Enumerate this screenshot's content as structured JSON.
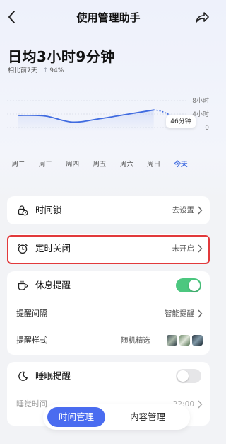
{
  "header": {
    "title": "使用管理助手"
  },
  "summary": {
    "daily_avg": "日均3小时9分钟",
    "compare_label": "相比前7天",
    "compare_pct": "94%"
  },
  "chart_data": {
    "type": "line",
    "categories": [
      "周二",
      "周三",
      "周四",
      "周五",
      "周六",
      "周日",
      "今天"
    ],
    "y_ticks": [
      "8小时",
      "4小时",
      "0"
    ],
    "ylabel": "",
    "ylim": [
      0,
      8
    ],
    "series": [
      {
        "values": [
          3.6,
          3.4,
          1.6,
          2.6,
          3.9,
          5.2,
          0.77
        ]
      }
    ],
    "annotation": "46分钟",
    "accent_color": "#3f6be0"
  },
  "card1": {
    "label": "时间锁",
    "value": "去设置"
  },
  "card2": {
    "label": "定时关闭",
    "value": "未开启"
  },
  "card3": {
    "label": "休息提醒",
    "toggle_on": true,
    "interval_label": "提醒间隔",
    "interval_value": "智能提醒",
    "style_label": "提醒样式",
    "style_value": "随机精选"
  },
  "card4": {
    "label": "睡眠提醒",
    "toggle_on": false,
    "sleep_label": "睡觉时间",
    "sleep_value": "22:00"
  },
  "tabs": {
    "active": "时间管理",
    "other": "内容管理"
  },
  "icons": [
    "back-arrow-icon",
    "share-icon",
    "lock-clock-icon",
    "alarm-clock-icon",
    "coffee-cup-icon",
    "moon-icon",
    "chevron-right-icon"
  ]
}
